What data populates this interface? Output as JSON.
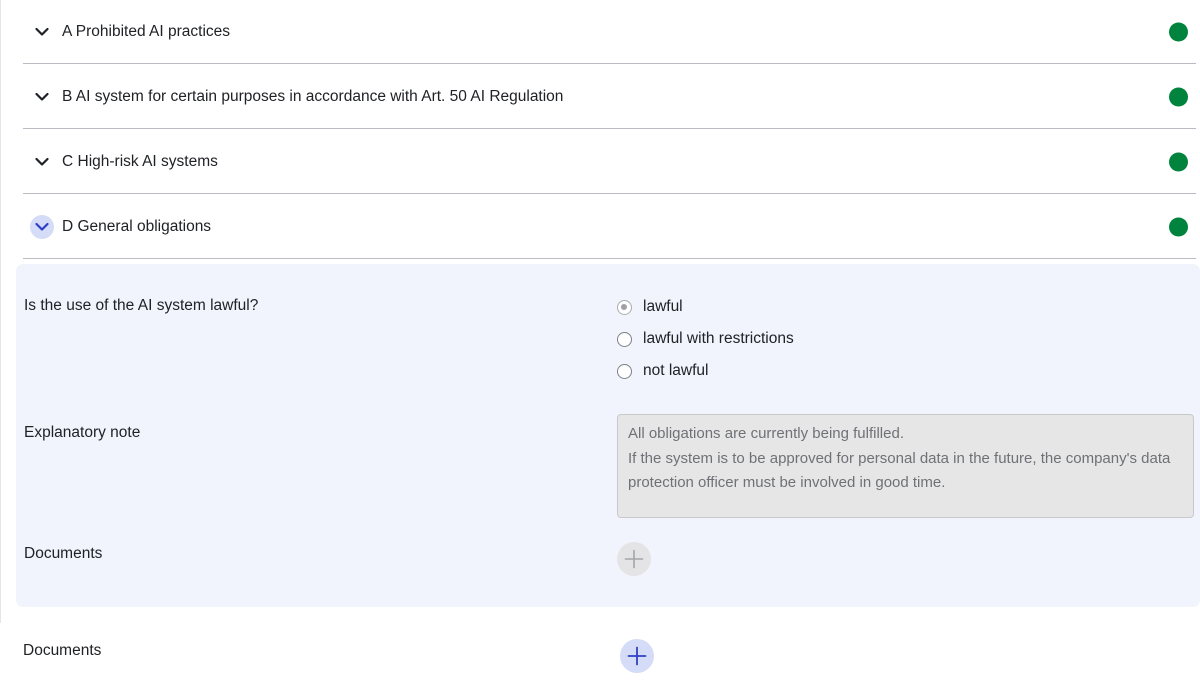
{
  "sections": [
    {
      "label": "A Prohibited AI practices",
      "expanded": false,
      "status_color": "#00843d"
    },
    {
      "label": "B AI system for certain purposes in accordance with Art. 50 AI Regulation",
      "expanded": false,
      "status_color": "#00843d"
    },
    {
      "label": "C High-risk AI systems",
      "expanded": false,
      "status_color": "#00843d"
    },
    {
      "label": "D General obligations",
      "expanded": true,
      "status_color": "#00843d"
    }
  ],
  "panel": {
    "question": "Is the use of the AI system lawful?",
    "options": [
      {
        "label": "lawful",
        "selected": true
      },
      {
        "label": "lawful with restrictions",
        "selected": false
      },
      {
        "label": "not lawful",
        "selected": false
      }
    ],
    "note_label": "Explanatory note",
    "note_lines": [
      "All obligations are currently being fulfilled.",
      "If the system is to be approved for personal data in the future,  the company's data",
      "protection officer must be involved in good time."
    ],
    "documents_label": "Documents",
    "documents_add_icon": "plus-icon"
  },
  "footer": {
    "documents_label": "Documents",
    "documents_add_icon": "plus-icon"
  },
  "colors": {
    "accent": "#2f3fc7",
    "accent_light": "#d4dcf7",
    "panel_bg": "#f1f4fd",
    "status_ok": "#00843d"
  }
}
